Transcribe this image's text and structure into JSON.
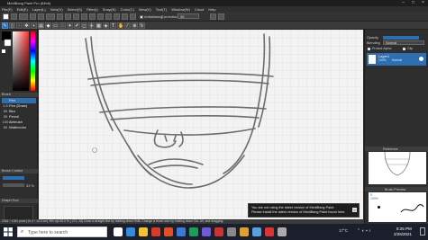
{
  "app": {
    "title": "MediBang Paint Pro (64bit)"
  },
  "menu": [
    "File(F)",
    "Edit(E)",
    "Layer(L)",
    "View(V)",
    "Select(S)",
    "Filter(I)",
    "Snap(N)",
    "Color(C)",
    "View(V)",
    "Tool(T)",
    "Window(W)",
    "Cloud",
    "Help"
  ],
  "toolbar": {
    "antialiasing_label": "Antialiasing",
    "correction_label": "Correction",
    "correction_value": "30"
  },
  "left_panel": {
    "brush_header": "Brush",
    "brushes": [
      {
        "size": "",
        "name": "Pen"
      },
      {
        "size": "1.5",
        "name": "Pen (Draw)"
      },
      {
        "size": "50",
        "name": "Blur"
      },
      {
        "size": "30",
        "name": "Pencil"
      },
      {
        "size": "100",
        "name": "Airbrush"
      },
      {
        "size": "50",
        "name": "Watercolor"
      }
    ],
    "brush_control_header": "Brush Control",
    "opacity_value": "33 %",
    "graph_header": "Graph Tool"
  },
  "right_panel": {
    "opacity_label": "Opacity",
    "blending_label": "Blending",
    "blending_value": "Normal",
    "protect_alpha_label": "Protect Alpha",
    "clip_label": "Clip",
    "layer_name": "Layer1",
    "layer_opacity": "100%",
    "layer_mode": "Normal",
    "navigator_header": "Reference",
    "brush_preview_header": "Brush Preview",
    "brush_preview_size": "5",
    "brush_preview_percent": "100%"
  },
  "status": {
    "text": "1061 * 1061 pixel   (10.4 * 10.4 cm)   350 dpi   40.0 %   ( 271, 28)   Draw a straight line by holding down Shift, Change a brush size by holding down Ctrl, Alt, and dragging"
  },
  "notice": {
    "line1": "You are not using the latest version of MediBang Paint.",
    "line2": "Please install the latest version of MediBang Paint found here."
  },
  "taskbar": {
    "search_placeholder": "Type here to search",
    "time": "8:25 PM",
    "date": "2/26/2021",
    "weather": "17°C",
    "colors": {
      "bg": "#1a1f2b",
      "accent": "#2d6fb0"
    }
  }
}
